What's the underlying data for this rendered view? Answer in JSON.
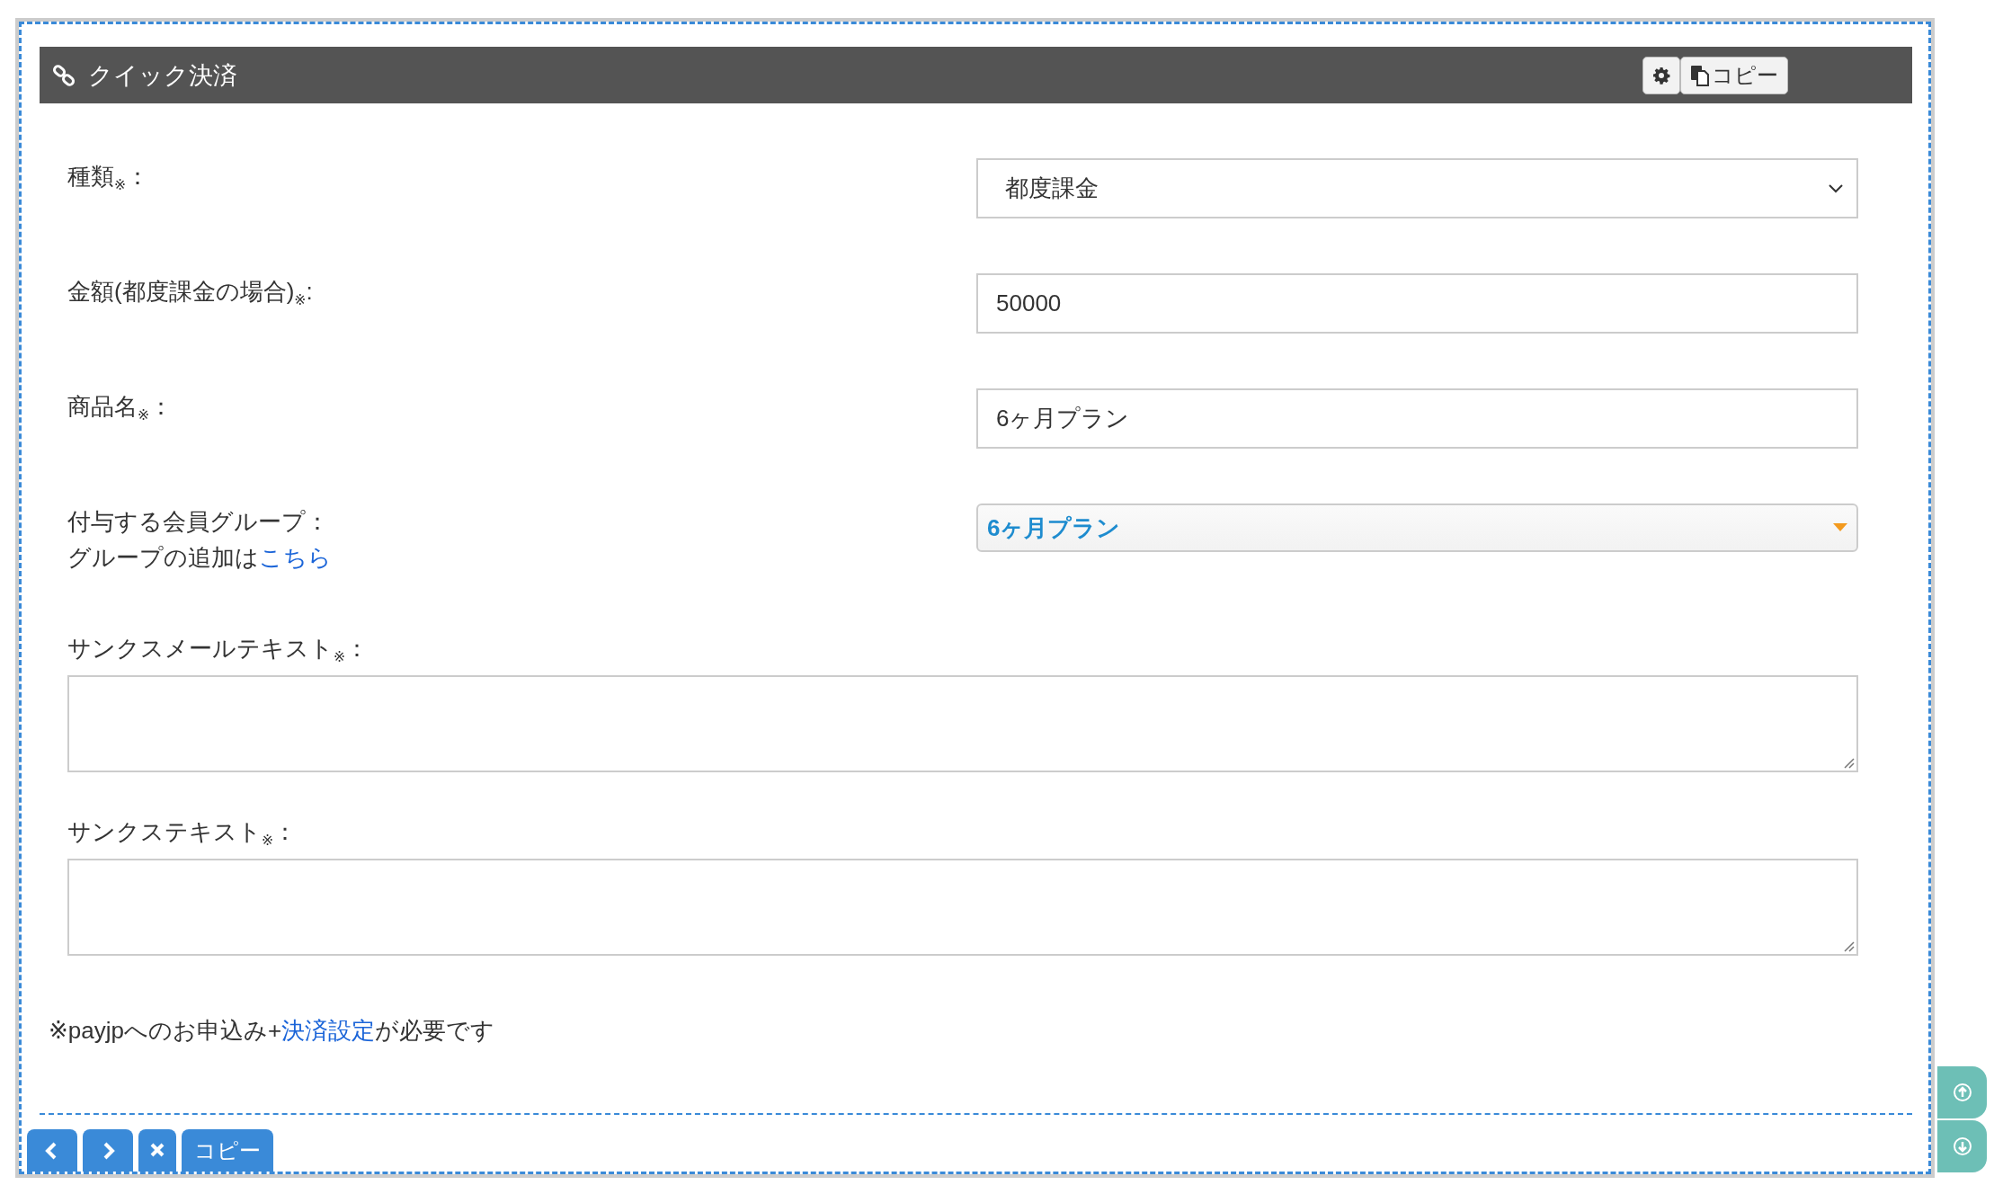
{
  "header": {
    "title": "クイック決済",
    "buttons": [
      {
        "kind": "settings"
      },
      {
        "kind": "copy",
        "label": "コピー"
      }
    ]
  },
  "fields": [
    {
      "kind": "select",
      "label": "種類$_{※}$：",
      "value": "都度課金"
    },
    {
      "kind": "input",
      "label": "金額(都度課金の場合)$_{※}$:",
      "value": "50000"
    },
    {
      "kind": "input",
      "label": "商品名$_{※}$：",
      "value": "6ヶ月プラン"
    },
    {
      "kind": "combo",
      "label": "付与する会員グループ：",
      "hint": "グループの追加は",
      "hint_link": "こちら",
      "value": "6ヶ月プラン"
    },
    {
      "kind": "textarea",
      "label": "サンクスメールテキスト$_{※}$："
    },
    {
      "kind": "textarea",
      "label": "サンクステキスト$_{※}$："
    }
  ],
  "note": {
    "before": "※payjpへのお申込み+",
    "link": "決済設定",
    "after": "が必要です"
  },
  "footer_buttons": [
    {
      "kind": "prev"
    },
    {
      "kind": "next"
    },
    {
      "kind": "close"
    },
    {
      "kind": "copy",
      "label": "コピー"
    }
  ],
  "side_buttons": [
    {
      "kind": "up"
    },
    {
      "kind": "down"
    }
  ]
}
